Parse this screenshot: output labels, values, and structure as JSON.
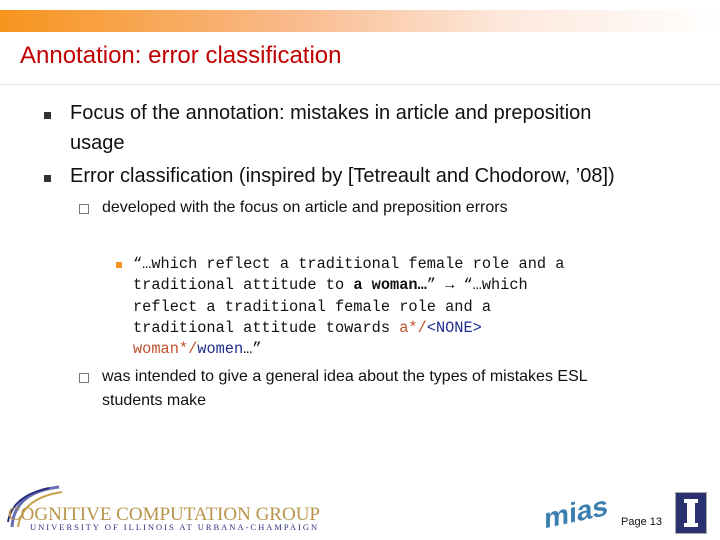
{
  "slide": {
    "title": "Annotation: error classification",
    "bullets": [
      {
        "line1": "Focus of the annotation: mistakes in article and preposition",
        "line2": "usage"
      },
      {
        "line1": "Error classification (inspired by [Tetreault and Chodorow, ’08])"
      }
    ],
    "sub1": "developed with the focus on article and preposition errors",
    "example": {
      "p1": "“…which reflect a traditional female role and a\ntraditional attitude to ",
      "bold": "a woman…",
      "p2": "” → “…which\nreflect a traditional female role and a\ntraditional attitude towards ",
      "err1": "a*/",
      "cor1": "<NONE>",
      "err2": "woman*/",
      "cor2": "women",
      "end": "…”"
    },
    "sub2_line1": "was intended to give a general idea about the types of mistakes ESL",
    "sub2_line2": "students make"
  },
  "footer": {
    "logo_text": "COGNITIVE COMPUTATION GROUP",
    "logo_sub": "UNIVERSITY OF ILLINOIS AT URBANA-CHAMPAIGN",
    "mias_logo": "mias",
    "page": "Page 13"
  },
  "colors": {
    "accent": "#f7941d",
    "title": "#c00000",
    "error": "#c0502a",
    "correction": "#1f2e8c"
  }
}
